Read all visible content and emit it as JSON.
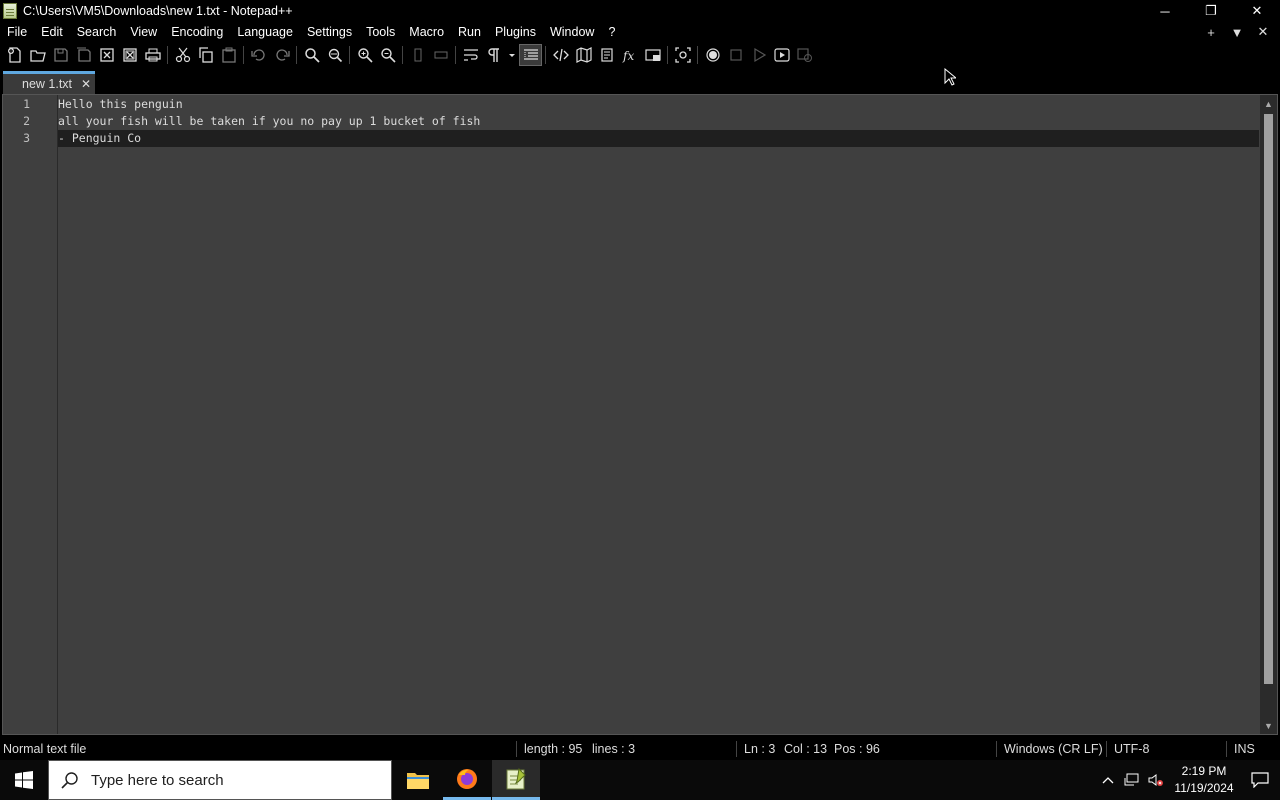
{
  "window": {
    "title": "C:\\Users\\VM5\\Downloads\\new 1.txt - Notepad++",
    "minimize_glyph": "─",
    "maximize_glyph": "❐",
    "close_glyph": "✕"
  },
  "menu": {
    "items": [
      "File",
      "Edit",
      "Search",
      "View",
      "Encoding",
      "Language",
      "Settings",
      "Tools",
      "Macro",
      "Run",
      "Plugins",
      "Window",
      "?"
    ],
    "right": [
      "+",
      "▼",
      "✕"
    ]
  },
  "toolbar": {
    "icons": [
      "new-file-icon",
      "open-file-icon",
      "save-icon",
      "save-all-icon",
      "close-icon",
      "close-all-icon",
      "print-icon",
      "cut-icon",
      "copy-icon",
      "paste-icon",
      "undo-icon",
      "redo-icon",
      "find-icon",
      "replace-icon",
      "zoom-in-icon",
      "zoom-out-icon",
      "sync-vertical-icon",
      "sync-horizontal-icon",
      "word-wrap-icon",
      "show-all-chars-icon",
      "indent-guide-icon",
      "xml-tag-icon",
      "document-map-icon",
      "function-list-icon",
      "fx-icon",
      "folder-workspace-icon",
      "monitoring-icon",
      "record-macro-icon",
      "stop-macro-icon",
      "play-macro-icon",
      "run-macro-multiple-icon",
      "save-macro-icon"
    ]
  },
  "tab": {
    "label": "new 1.txt",
    "close": "✕"
  },
  "editor": {
    "lines": [
      {
        "num": "1",
        "text": "Hello this penguin"
      },
      {
        "num": "2",
        "text": "all your fish will be taken if you no pay up 1 bucket of fish"
      },
      {
        "num": "3",
        "text": "- Penguin Co"
      }
    ],
    "current_line": 3
  },
  "status": {
    "file_type": "Normal text file",
    "length": "length : 95",
    "lines": "lines : 3",
    "ln": "Ln : 3",
    "col": "Col : 13",
    "pos": "Pos : 96",
    "eol": "Windows (CR LF)",
    "encoding": "UTF-8",
    "mode": "INS"
  },
  "taskbar": {
    "search_placeholder": "Type here to search",
    "time": "2:19 PM",
    "date": "11/19/2024"
  },
  "colors": {
    "accent": "#5fa8e0",
    "editor_bg": "#3f3f3f",
    "current_line_bg": "#1f1f1f"
  }
}
